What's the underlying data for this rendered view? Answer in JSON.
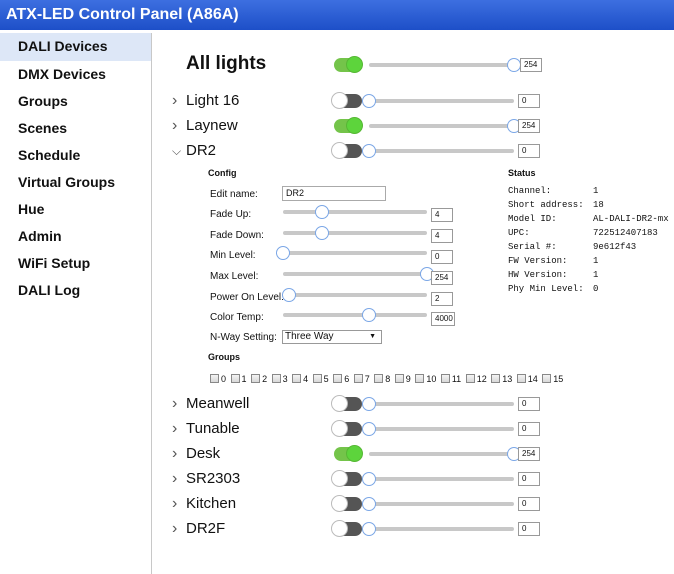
{
  "app": {
    "title": "ATX-LED Control Panel (A86A)"
  },
  "sidebar": {
    "items": [
      {
        "label": "DALI Devices",
        "active": true
      },
      {
        "label": "DMX Devices"
      },
      {
        "label": "Groups"
      },
      {
        "label": "Scenes"
      },
      {
        "label": "Schedule"
      },
      {
        "label": "Virtual Groups"
      },
      {
        "label": "Hue"
      },
      {
        "label": "Admin"
      },
      {
        "label": "WiFi Setup"
      },
      {
        "label": "DALI Log"
      }
    ]
  },
  "all_lights": {
    "label": "All lights",
    "on": true,
    "level": 254,
    "max": 254,
    "value": "254"
  },
  "devices": [
    {
      "name": "Light 16",
      "expanded": false,
      "on": false,
      "level": 0,
      "max": 254,
      "value": "0"
    },
    {
      "name": "Laynew",
      "expanded": false,
      "on": true,
      "level": 254,
      "max": 254,
      "value": "254"
    },
    {
      "name": "DR2",
      "expanded": true,
      "on": false,
      "level": 0,
      "max": 254,
      "value": "0"
    },
    {
      "name": "Meanwell",
      "expanded": false,
      "on": false,
      "level": 0,
      "max": 254,
      "value": "0"
    },
    {
      "name": "Tunable",
      "expanded": false,
      "on": false,
      "level": 0,
      "max": 254,
      "value": "0"
    },
    {
      "name": "Desk",
      "expanded": false,
      "on": true,
      "level": 254,
      "max": 254,
      "value": "254"
    },
    {
      "name": "SR2303",
      "expanded": false,
      "on": false,
      "level": 0,
      "max": 254,
      "value": "0"
    },
    {
      "name": "Kitchen",
      "expanded": false,
      "on": false,
      "level": 0,
      "max": 254,
      "value": "0"
    },
    {
      "name": "DR2F",
      "expanded": false,
      "on": false,
      "level": 0,
      "max": 254,
      "value": "0"
    }
  ],
  "config": {
    "heading": "Config",
    "edit_name": {
      "label": "Edit name:",
      "value": "DR2"
    },
    "fade_up": {
      "label": "Fade Up:",
      "value": "4",
      "fraction": 0.27
    },
    "fade_down": {
      "label": "Fade Down:",
      "value": "4",
      "fraction": 0.27
    },
    "min_level": {
      "label": "Min Level:",
      "value": "0",
      "fraction": 0.0
    },
    "max_level": {
      "label": "Max Level:",
      "value": "254",
      "fraction": 1.0
    },
    "power_on_level": {
      "label": "Power On Level:",
      "value": "2",
      "fraction": 0.01
    },
    "color_temp": {
      "label": "Color Temp:",
      "value": "4000",
      "fraction": 0.6
    },
    "nway": {
      "label": "N-Way Setting:",
      "value": "Three Way"
    }
  },
  "groups": {
    "heading": "Groups",
    "items": [
      "0",
      "1",
      "2",
      "3",
      "4",
      "5",
      "6",
      "7",
      "8",
      "9",
      "10",
      "11",
      "12",
      "13",
      "14",
      "15"
    ]
  },
  "status": {
    "heading": "Status",
    "rows": [
      {
        "label": "Channel:",
        "value": "1"
      },
      {
        "label": "Short address:",
        "value": "18"
      },
      {
        "label": "Model ID:",
        "value": "AL-DALI-DR2-mx"
      },
      {
        "label": "UPC:",
        "value": "722512407183"
      },
      {
        "label": "Serial #:",
        "value": "9e612f43"
      },
      {
        "label": "FW Version:",
        "value": "1"
      },
      {
        "label": "HW Version:",
        "value": "1"
      },
      {
        "label": "Phy Min Level:",
        "value": "0"
      }
    ]
  },
  "colors": {
    "titlebar": "#2a5bd7",
    "toggle_on": "#5dd43c",
    "toggle_off": "#555555",
    "slider_thumb_border": "#7aa6e6",
    "sidebar_active": "#dde7f7"
  }
}
